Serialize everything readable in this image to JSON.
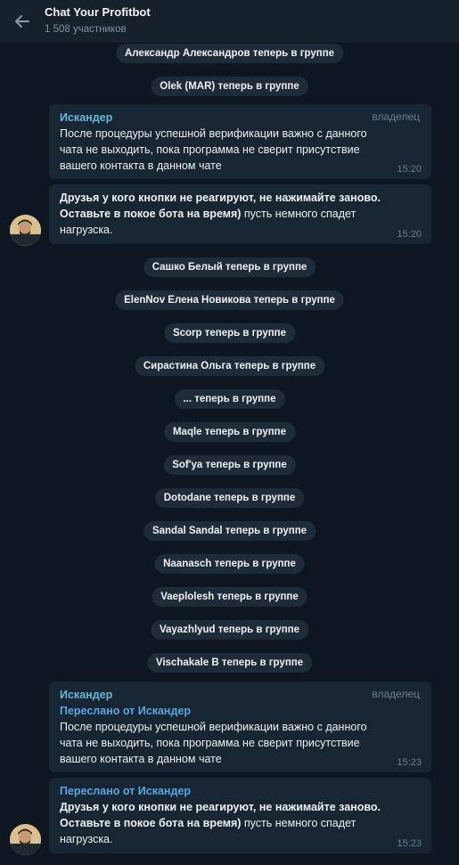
{
  "header": {
    "title": "Chat Your Profitbot",
    "subtitle": "1 508 участников"
  },
  "events": [
    "Александр Александров теперь в группе",
    "Olek (MAR) теперь в группе",
    "Сашко Белый теперь в группе",
    "ElenNov Елена Новикова теперь в группе",
    "Scorp теперь в группе",
    "Сирастина Ольга теперь в группе",
    "... теперь в группе",
    "Maqle теперь в группе",
    "Sof'ya теперь в группе",
    "Dotodane теперь в группе",
    "Sandal Sandal теперь в группе",
    "Naanasch теперь в группе",
    "Vaeplolesh теперь в группе",
    "Vayazhlyud теперь в группе",
    "Vischakale B теперь в группе"
  ],
  "messages": [
    {
      "sender": "Искандер",
      "role": "владелец",
      "text": "После процедуры успешной верификации важно с данного чата не выходить, пока программа не сверит присутствие вашего контакта в данном чате",
      "time": "15:20"
    },
    {
      "text_bold": "Друзья у кого кнопки не реагируют, не нажимайте заново. Оставьте в покое бота на время)",
      "text_rest": " пусть немного спадет нагрузска.",
      "time": "15:20"
    },
    {
      "sender": "Искандер",
      "role": "владелец",
      "forwarded": "Переслано от Искандер",
      "text": "После процедуры успешной верификации важно с данного чата не выходить, пока программа не сверит присутствие вашего контакта в данном чате",
      "time": "15:23"
    },
    {
      "forwarded": "Переслано от Искандер",
      "text_bold": "Друзья у кого кнопки не реагируют, не нажимайте заново. Оставьте в покое бота на время)",
      "text_rest": " пусть немного спадет нагрузска.",
      "time": "15:23"
    }
  ],
  "colors": {
    "background": "#0e1621",
    "header": "#17212b",
    "bubble": "#182533",
    "pill": "#1e2c3a",
    "sender": "#67b8d8",
    "forwarded": "#5aa7e2"
  },
  "icons": {
    "back": "arrow-left-icon",
    "avatar": "user-avatar"
  }
}
